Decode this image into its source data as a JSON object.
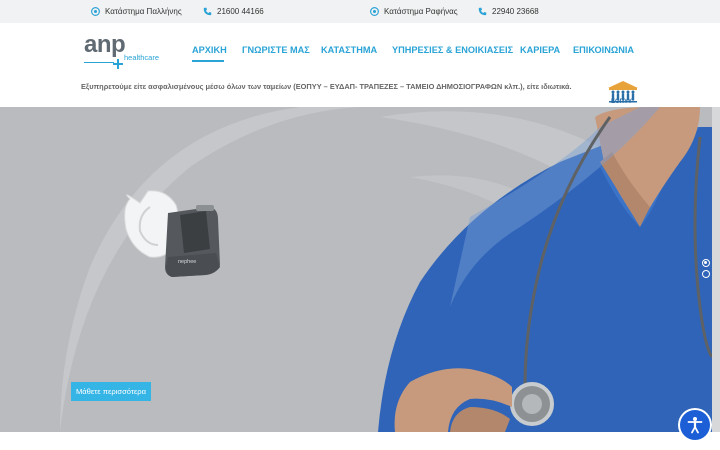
{
  "topbar": {
    "store1_label": "Κατάστημα Παλλήνης",
    "phone1": "21600 44166",
    "store2_label": "Κατάστημα Ραφήνας",
    "phone2": "22940 23668"
  },
  "logo": {
    "main": "anp",
    "sub": "healthcare"
  },
  "nav": {
    "items": [
      {
        "label": "ΑΡΧΙΚΗ",
        "active": true
      },
      {
        "label": "ΓΝΩΡΙΣΤΕ ΜΑΣ"
      },
      {
        "label": "ΚΑΤΑΣΤΗΜΑ"
      },
      {
        "label": "ΥΠΗΡΕΣΙΕΣ & ΕΝΟΙΚΙΑΣΕΙΣ"
      },
      {
        "label": "ΚΑΡΙΕΡΑ"
      },
      {
        "label": "ΕΠΙΚΟΙΝΩΝΙΑ"
      }
    ]
  },
  "insurance_text": "Εξυπηρετούμε είτε ασφαλισμένους μέσω όλων των ταμείων (ΕΟΠΥΥ – ΕΥΔΑΠ- ΤΡΑΠΕΖΕΣ – ΤΑΜΕΙΟ ΔΗΜΟΣΙΟΓΡΑΦΩΝ κλπ.), είτε ιδιωτικά.",
  "eopyy_label": "ΕΟΠΥΥ",
  "hero": {
    "device_brand": "nephee",
    "cta_label": "Μάθετε περισσότερα",
    "slides": 2,
    "active_slide": 1
  },
  "colors": {
    "accent": "#2aa3d6",
    "cta": "#35b4e6",
    "topbar_bg": "#f1f2f3",
    "hero_bg": "#b9bbbe",
    "scrub_blue": "#2f64b8",
    "a11y_blue": "#1c5ed6"
  },
  "icons": [
    "location-icon",
    "phone-icon",
    "accessibility-icon"
  ]
}
